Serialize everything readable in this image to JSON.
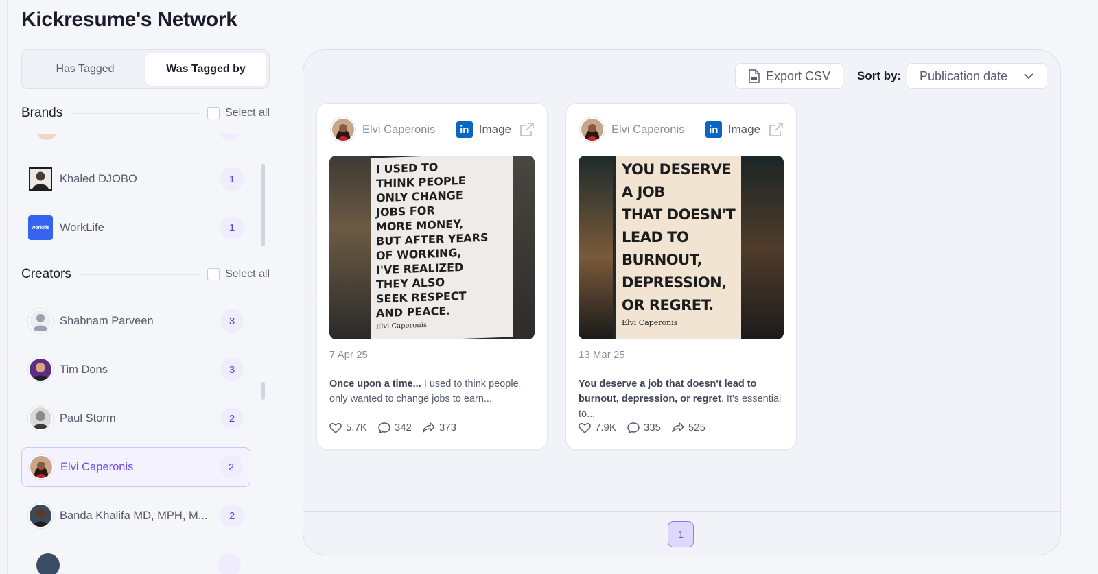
{
  "page": {
    "title": "Kickresume's Network"
  },
  "toggle": {
    "has_tagged": "Has Tagged",
    "was_tagged_by": "Was Tagged by"
  },
  "brands": {
    "label": "Brands",
    "select_all": "Select all",
    "items": [
      {
        "name": "Khaled DJOBO",
        "count": "1"
      },
      {
        "name": "WorkLife",
        "count": "1"
      }
    ]
  },
  "creators": {
    "label": "Creators",
    "select_all": "Select all",
    "items": [
      {
        "name": "Shabnam Parveen",
        "count": "3"
      },
      {
        "name": "Tim Dons",
        "count": "3"
      },
      {
        "name": "Paul Storm",
        "count": "2"
      },
      {
        "name": "Elvi Caperonis",
        "count": "2"
      },
      {
        "name": "Banda Khalifa MD, MPH, M...",
        "count": "2"
      }
    ]
  },
  "toolbar": {
    "export_label": "Export CSV",
    "sort_label": "Sort by:",
    "sort_value": "Publication date"
  },
  "posts": [
    {
      "author": "Elvi Caperonis",
      "type": "Image",
      "image_lines": [
        "I USED TO",
        "THINK PEOPLE",
        "ONLY CHANGE",
        "JOBS FOR",
        "MORE MONEY,",
        "BUT AFTER YEARS",
        "OF WORKING,",
        "I'VE REALIZED",
        "THEY ALSO",
        "SEEK RESPECT",
        "AND PEACE."
      ],
      "image_signature": "Elvi Caperonis",
      "date": "7 Apr 25",
      "text_bold": "Once upon a time...",
      "text_rest": " I used to think people only wanted to change jobs to earn...",
      "likes": "5.7K",
      "comments": "342",
      "shares": "373"
    },
    {
      "author": "Elvi Caperonis",
      "type": "Image",
      "image_lines": [
        "YOU DESERVE",
        "A JOB",
        "THAT DOESN'T",
        "LEAD TO",
        "BURNOUT,",
        "DEPRESSION,",
        "OR REGRET."
      ],
      "image_signature": "Elvi Caperonis",
      "date": "13 Mar 25",
      "text_bold": "You deserve a job that doesn't lead to burnout, depression, or regret",
      "text_rest": ". It's essential to...",
      "likes": "7.9K",
      "comments": "335",
      "shares": "525"
    }
  ],
  "pagination": {
    "current": "1"
  },
  "colors": {
    "accent": "#6a4fe0",
    "linkedin": "#0a66c2",
    "count_bg": "#efedfd"
  },
  "brand_logo_text": "worklife"
}
